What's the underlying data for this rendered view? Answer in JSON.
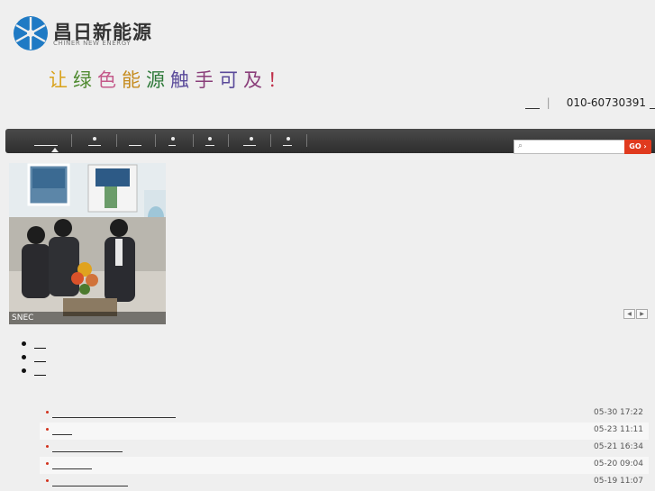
{
  "brand": {
    "name_cn": "昌日新能源",
    "name_en": "CHINER NEW ENERGY",
    "colors": {
      "logo_blue": "#1f7ac4"
    }
  },
  "slogan": {
    "chars": [
      {
        "c": "让",
        "color": "#d9a21a"
      },
      {
        "c": "绿",
        "color": "#4e8a2f"
      },
      {
        "c": "色",
        "color": "#c45a8a"
      },
      {
        "c": "能",
        "color": "#c58b1d"
      },
      {
        "c": "源",
        "color": "#2f7a3a"
      },
      {
        "c": "触",
        "color": "#5a4a9a"
      },
      {
        "c": "手",
        "color": "#8a3e7a"
      },
      {
        "c": "可",
        "color": "#5a4a9a"
      },
      {
        "c": "及",
        "color": "#8a3e7a"
      },
      {
        "c": "！",
        "color": "#c0304a"
      }
    ]
  },
  "header": {
    "phone": "010-60730391",
    "separator": "|"
  },
  "search": {
    "placeholder": "",
    "go_label": "GO ›"
  },
  "slider": {
    "caption": "SNEC",
    "prev_label": "◀",
    "next_label": "▶"
  },
  "news": [
    {
      "date": "05-30 17:22"
    },
    {
      "date": "05-23 11:11"
    },
    {
      "date": "05-21 16:34"
    },
    {
      "date": "05-20 09:04"
    },
    {
      "date": "05-19 11:07"
    }
  ],
  "icons": {
    "search": "search-icon",
    "logo": "sun-wheel-icon"
  }
}
